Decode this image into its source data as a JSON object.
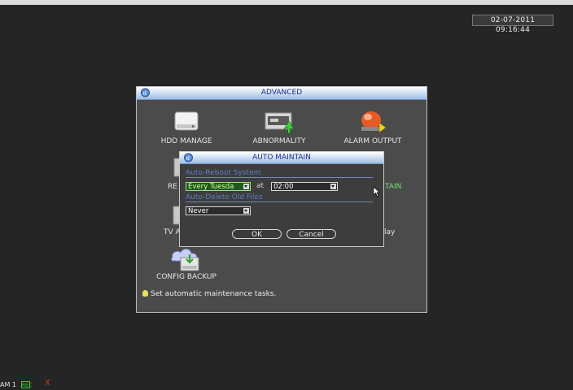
{
  "screen": {
    "timestamp": "02-07-2011 09:16:44"
  },
  "advanced_window": {
    "title": "ADVANCED",
    "tiles": [
      {
        "id": "hdd",
        "label": "HDD MANAGE",
        "icon": "hdd-icon"
      },
      {
        "id": "abnormality",
        "label": "ABNORMALITY",
        "icon": "monitor-alert-icon"
      },
      {
        "id": "alarm",
        "label": "ALARM OUTPUT",
        "icon": "alarm-icon"
      },
      {
        "id": "record",
        "label": "RE",
        "icon": "record-icon"
      },
      {
        "id": "maintain",
        "label": "TAIN",
        "icon": "maintain-icon"
      },
      {
        "id": "tv",
        "label": "TV A",
        "icon": "tv-icon"
      },
      {
        "id": "display",
        "label": "lay",
        "icon": "display-icon"
      },
      {
        "id": "config",
        "label": "CONFIG BACKUP",
        "icon": "config-backup-icon"
      }
    ],
    "hint": "Set automatic maintenance tasks."
  },
  "auto_maintain": {
    "title": "AUTO MAINTAIN",
    "reboot_section": "Auto-Reboot System",
    "reboot_day": "Every Tuesda",
    "at_label": "at",
    "reboot_time": "02:00",
    "delete_section": "Auto-Delete Old Files",
    "delete_value": "Never",
    "ok_label": "OK",
    "cancel_label": "Cancel"
  },
  "status_bar": {
    "channel_text": "AM 1",
    "rec_badge": "REC",
    "alert_mark": "X"
  },
  "colors": {
    "title_text": "#1c2f8e",
    "section_label": "#5d7dc4",
    "focus_green": "#1f5a1f",
    "alert_red": "#cc3a1e"
  }
}
